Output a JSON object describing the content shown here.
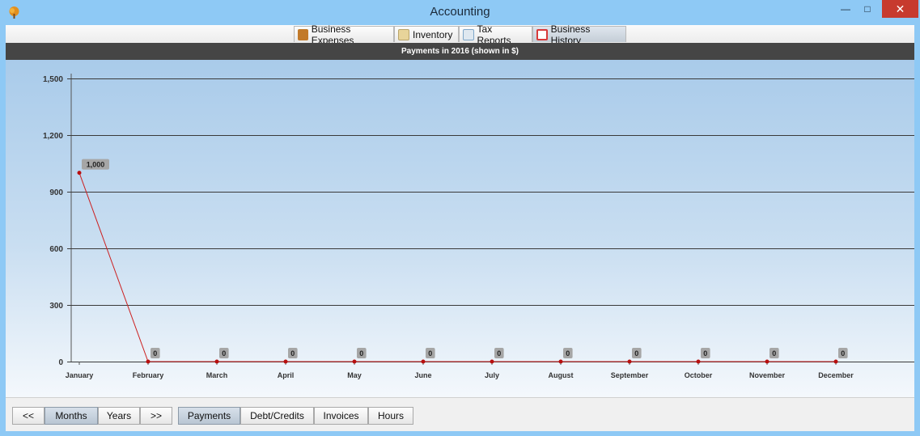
{
  "window": {
    "title": "Accounting",
    "minimize_glyph": "—",
    "maximize_glyph": "□",
    "close_glyph": "✕"
  },
  "tabs": [
    {
      "label": "Business Expenses",
      "icon": "money-bag-icon",
      "icon_color": "#c27a2a"
    },
    {
      "label": "Inventory",
      "icon": "clipboard-icon",
      "icon_color": "#e8d49a"
    },
    {
      "label": "Tax Reports",
      "icon": "tax-report-icon",
      "icon_color": "#7fa7c9"
    },
    {
      "label": "Business History",
      "icon": "calendar-icon",
      "icon_color": "#d83a3a",
      "active": true
    }
  ],
  "chart_header": "Payments in 2016 (shown in $)",
  "chart_data": {
    "type": "line",
    "title": "Payments in 2016 (shown in $)",
    "categories": [
      "January",
      "February",
      "March",
      "April",
      "May",
      "June",
      "July",
      "August",
      "September",
      "October",
      "November",
      "December"
    ],
    "values": [
      1000,
      0,
      0,
      0,
      0,
      0,
      0,
      0,
      0,
      0,
      0,
      0
    ],
    "data_labels": [
      "1,000",
      "0",
      "0",
      "0",
      "0",
      "0",
      "0",
      "0",
      "0",
      "0",
      "0",
      "0"
    ],
    "yticks": [
      0,
      300,
      600,
      900,
      1200,
      1500
    ],
    "ytick_labels": [
      "0",
      "300",
      "600",
      "900",
      "1,200",
      "1,500"
    ],
    "ylim": [
      0,
      1500
    ],
    "grid": true,
    "line_color": "#cc1f1f",
    "marker_color": "#b80f0f",
    "label_bg": "#a6a6a6"
  },
  "bottom": {
    "prev_label": "<<",
    "months_label": "Months",
    "years_label": "Years",
    "next_label": ">>",
    "payments_label": "Payments",
    "debt_label": "Debt/Credits",
    "invoices_label": "Invoices",
    "hours_label": "Hours"
  }
}
